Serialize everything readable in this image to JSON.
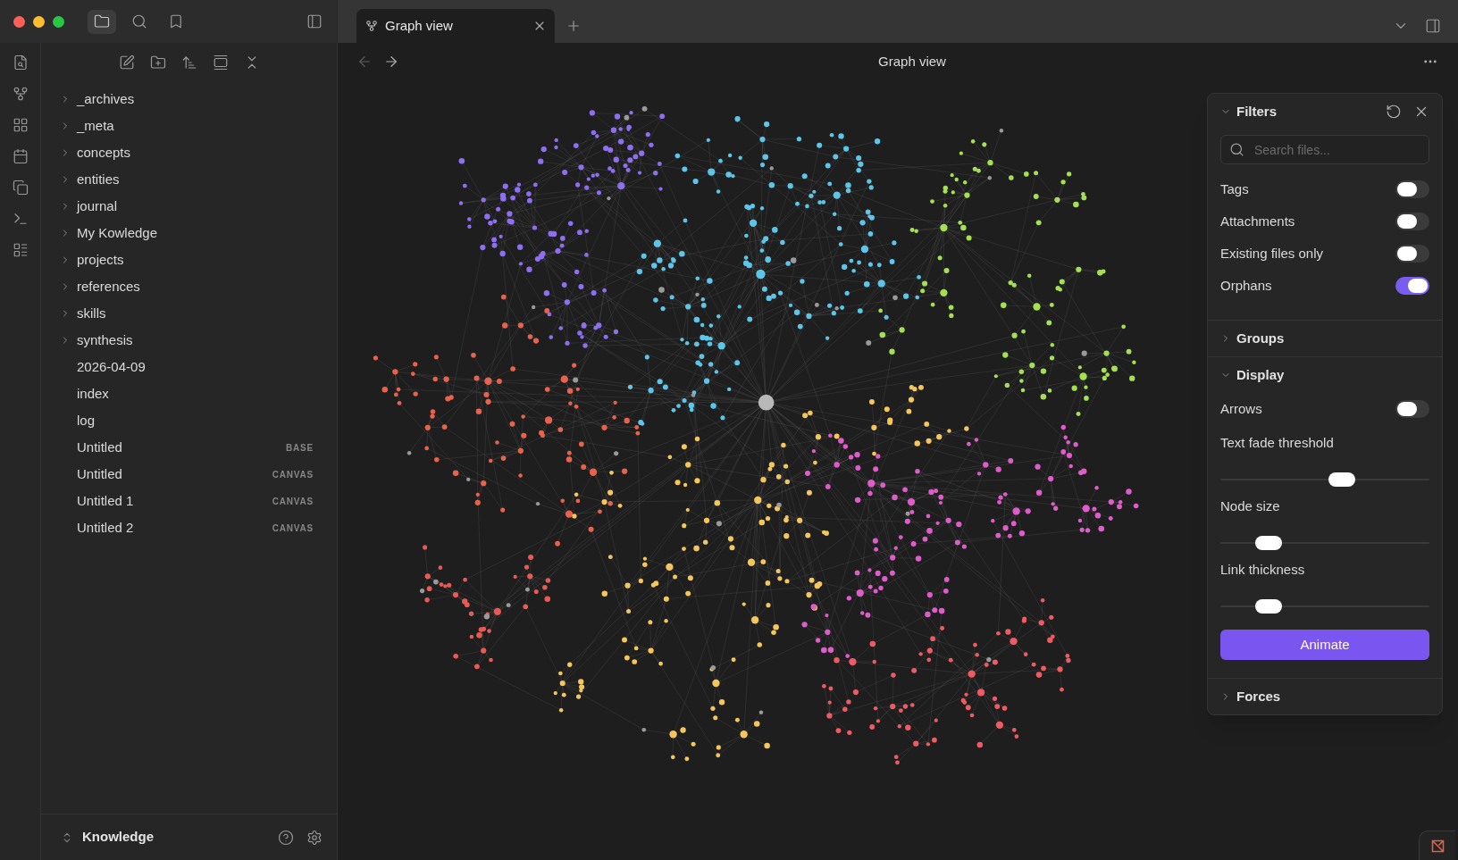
{
  "tabs": [
    {
      "label": "Graph view",
      "selected": true
    }
  ],
  "view": {
    "title": "Graph view"
  },
  "file_tree": [
    {
      "name": "_archives",
      "kind": "folder",
      "expanded": false
    },
    {
      "name": "_meta",
      "kind": "folder",
      "expanded": false
    },
    {
      "name": "concepts",
      "kind": "folder",
      "expanded": false
    },
    {
      "name": "entities",
      "kind": "folder",
      "expanded": false
    },
    {
      "name": "journal",
      "kind": "folder",
      "expanded": false
    },
    {
      "name": "My Kowledge",
      "kind": "folder",
      "expanded": false
    },
    {
      "name": "projects",
      "kind": "folder",
      "expanded": false
    },
    {
      "name": "references",
      "kind": "folder",
      "expanded": false
    },
    {
      "name": "skills",
      "kind": "folder",
      "expanded": false
    },
    {
      "name": "synthesis",
      "kind": "folder",
      "expanded": false
    },
    {
      "name": "2026-04-09",
      "kind": "file"
    },
    {
      "name": "index",
      "kind": "file"
    },
    {
      "name": "log",
      "kind": "file"
    },
    {
      "name": "Untitled",
      "kind": "file",
      "badge": "BASE"
    },
    {
      "name": "Untitled",
      "kind": "file",
      "badge": "CANVAS"
    },
    {
      "name": "Untitled 1",
      "kind": "file",
      "badge": "CANVAS"
    },
    {
      "name": "Untitled 2",
      "kind": "file",
      "badge": "CANVAS"
    }
  ],
  "vault": {
    "name": "Knowledge"
  },
  "graph_filters": {
    "sections": [
      {
        "title": "Filters",
        "expanded": true,
        "controls": [
          {
            "kind": "search",
            "placeholder": "Search files..."
          },
          {
            "kind": "toggle",
            "label": "Tags",
            "on": false
          },
          {
            "kind": "toggle",
            "label": "Attachments",
            "on": false
          },
          {
            "kind": "toggle",
            "label": "Existing files only",
            "on": false
          },
          {
            "kind": "toggle",
            "label": "Orphans",
            "on": true
          }
        ]
      },
      {
        "title": "Groups",
        "expanded": false
      },
      {
        "title": "Display",
        "expanded": true,
        "controls": [
          {
            "kind": "toggle",
            "label": "Arrows",
            "on": false
          },
          {
            "kind": "slider",
            "label": "Text fade threshold",
            "level": 0.58
          },
          {
            "kind": "slider",
            "label": "Node size",
            "level": 0.23
          },
          {
            "kind": "slider",
            "label": "Link thickness",
            "level": 0.23
          },
          {
            "kind": "button",
            "label": "Animate"
          }
        ]
      },
      {
        "title": "Forces",
        "expanded": false
      }
    ]
  }
}
